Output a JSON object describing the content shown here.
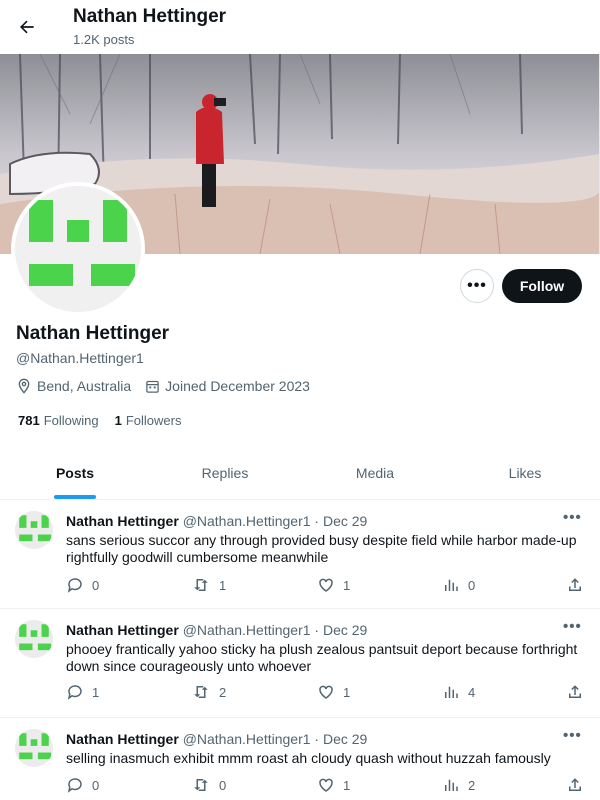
{
  "header": {
    "title": "Nathan Hettinger",
    "subtitle": "1.2K posts"
  },
  "profile": {
    "name": "Nathan Hettinger",
    "handle": "@Nathan.Hettinger1",
    "location": "Bend, Australia",
    "joined": "Joined December 2023",
    "following_count": "781",
    "following_label": "Following",
    "followers_count": "1",
    "followers_label": "Followers",
    "follow_label": "Follow",
    "more_label": "•••"
  },
  "tabs": [
    {
      "label": "Posts",
      "active": true
    },
    {
      "label": "Replies",
      "active": false
    },
    {
      "label": "Media",
      "active": false
    },
    {
      "label": "Likes",
      "active": false
    }
  ],
  "posts": [
    {
      "name": "Nathan Hettinger",
      "handle": "@Nathan.Hettinger1",
      "dot": "·",
      "date": "Dec 29",
      "more": "•••",
      "text": "sans serious succor any through provided busy despite field while harbor made-up rightfully goodwill cumbersome meanwhile",
      "replies": "0",
      "reposts": "1",
      "likes": "1",
      "views": "0"
    },
    {
      "name": "Nathan Hettinger",
      "handle": "@Nathan.Hettinger1",
      "dot": "·",
      "date": "Dec 29",
      "more": "•••",
      "text": "phooey frantically yahoo sticky ha plush zealous pantsuit deport because forthright down since courageously unto whoever",
      "replies": "1",
      "reposts": "2",
      "likes": "1",
      "views": "4"
    },
    {
      "name": "Nathan Hettinger",
      "handle": "@Nathan.Hettinger1",
      "dot": "·",
      "date": "Dec 29",
      "more": "•••",
      "text": "selling inasmuch exhibit mmm roast ah cloudy quash without huzzah famously",
      "replies": "0",
      "reposts": "0",
      "likes": "1",
      "views": "2"
    }
  ],
  "colors": {
    "accent": "#1d9bf0",
    "avatar_green": "#4cd34c",
    "text_primary": "#0f1419",
    "text_secondary": "#536471"
  },
  "icons": {
    "back": "arrow-left-icon",
    "location": "location-pin-icon",
    "calendar": "calendar-icon",
    "reply": "reply-icon",
    "repost": "repost-icon",
    "like": "heart-icon",
    "views": "views-icon",
    "share": "share-icon"
  }
}
